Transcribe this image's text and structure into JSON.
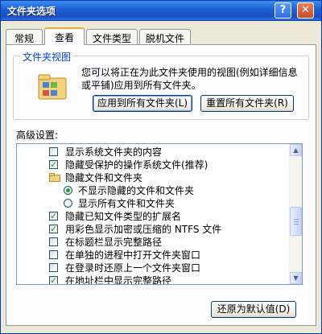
{
  "window": {
    "title": "文件夹选项"
  },
  "titlebar": {
    "help_glyph": "?",
    "close_glyph": "✕"
  },
  "tabs": [
    {
      "label": "常规",
      "active": false
    },
    {
      "label": "查看",
      "active": true
    },
    {
      "label": "文件类型",
      "active": false
    },
    {
      "label": "脱机文件",
      "active": false
    }
  ],
  "folder_views": {
    "title": "文件夹视图",
    "description": "您可以将正在为此文件夹使用的视图(例如详细信息或平铺)应用到所有文件夹。",
    "apply_button": "应用到所有文件夹(L)",
    "reset_button": "重置所有文件夹(R)"
  },
  "advanced": {
    "label": "高级设置:",
    "items": [
      {
        "type": "checkbox",
        "label": "显示系统文件夹的内容",
        "checked": false
      },
      {
        "type": "checkbox",
        "label": "隐藏受保护的操作系统文件(推荐)",
        "checked": true
      },
      {
        "type": "folder",
        "label": "隐藏文件和文件夹"
      },
      {
        "type": "radio",
        "label": "不显示隐藏的文件和文件夹",
        "checked": true
      },
      {
        "type": "radio",
        "label": "显示所有文件和文件夹",
        "checked": false
      },
      {
        "type": "checkbox",
        "label": "隐藏已知文件类型的扩展名",
        "checked": true
      },
      {
        "type": "checkbox",
        "label": "用彩色显示加密或压缩的 NTFS 文件",
        "checked": true
      },
      {
        "type": "checkbox",
        "label": "在标题栏显示完整路径",
        "checked": false
      },
      {
        "type": "checkbox",
        "label": "在单独的进程中打开文件夹窗口",
        "checked": false
      },
      {
        "type": "checkbox",
        "label": "在登录时还原上一个文件夹窗口",
        "checked": false
      },
      {
        "type": "checkbox",
        "label": "在地址栏中显示完整路径",
        "checked": true
      }
    ]
  },
  "restore_defaults_button": "还原为默认值(D)",
  "colors": {
    "title_blue": "#1d5fd4",
    "group_title": "#0046d5",
    "check_green": "#21a121",
    "tab_highlight": "#e7a33c"
  }
}
